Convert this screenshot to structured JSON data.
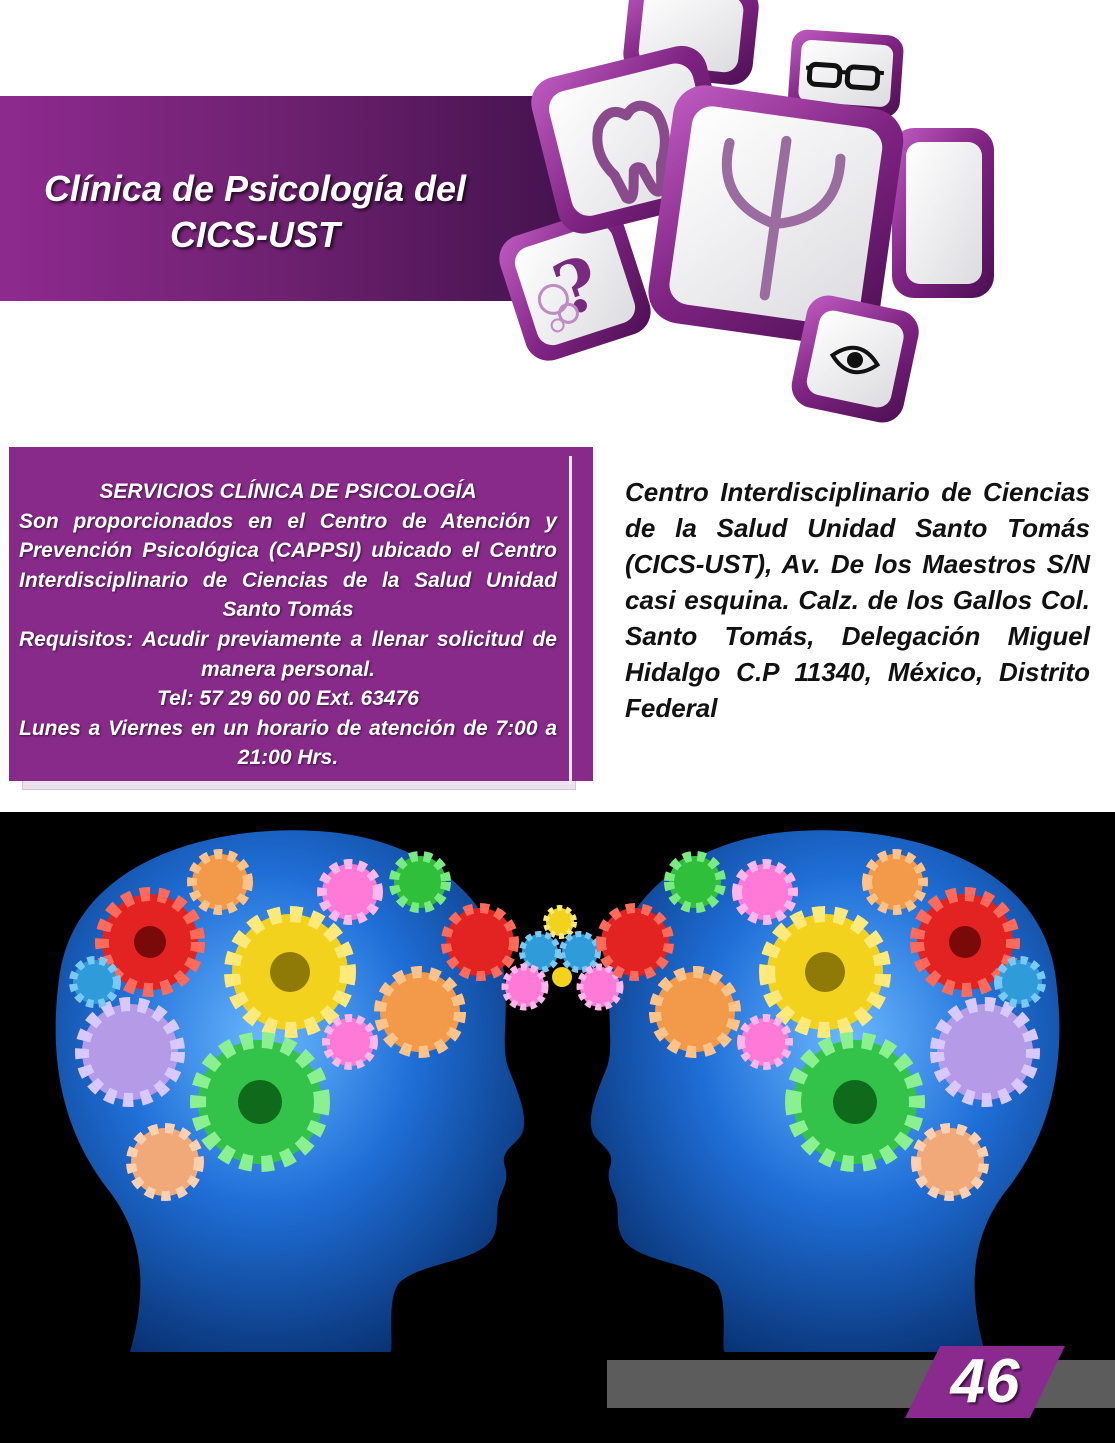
{
  "header": {
    "title_line1": "Clínica de Psicología del",
    "title_line2": "CICS-UST",
    "icons": [
      "tooth-icon",
      "glasses-icon",
      "psi-icon",
      "question-icon",
      "eye-icon"
    ]
  },
  "services": {
    "heading": "SERVICIOS CLÍNICA DE PSICOLOGÍA",
    "description": "Son proporcionados en el Centro de Atención y Prevención Psicológica (CAPPSI) ubicado el Centro Interdisciplinario de Ciencias de la Salud Unidad Santo Tomás",
    "requirements": "Requisitos: Acudir previamente a llenar solicitud de manera personal.",
    "phone": "Tel: 57 29 60 00 Ext. 63476",
    "schedule": "Lunes a Viernes en un horario de atención de 7:00 a 21:00 Hrs."
  },
  "address": {
    "text": "Centro Interdisciplinario de Ciencias de la Salud Unidad Santo Tomás (CICS-UST), Av. De los Maestros S/N casi esquina. Calz. de los Gallos Col. Santo Tomás, Delegación Miguel Hidalgo C.P 11340, México, Distrito Federal"
  },
  "footer": {
    "page_number": "46"
  },
  "colors": {
    "accent_purple": "#872a8a",
    "footer_gray": "#5c5c5c",
    "head_blue": "#1f6fd8"
  }
}
